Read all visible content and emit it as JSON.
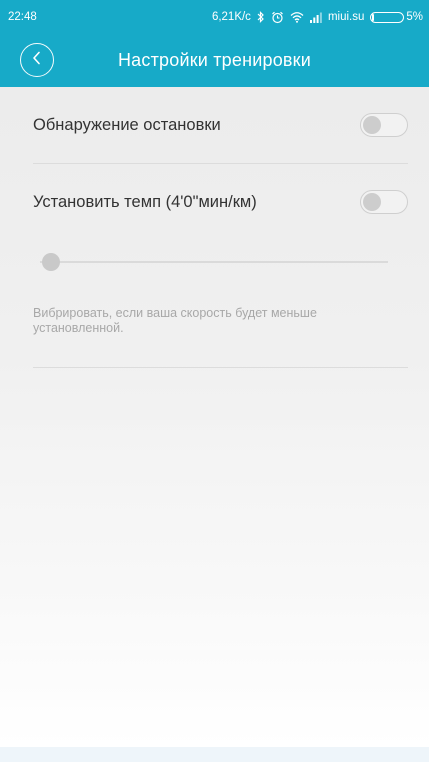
{
  "status_bar": {
    "time": "22:48",
    "net_speed": "6,21K/c",
    "carrier": "miui.su",
    "battery": "5%",
    "icons": [
      "bluetooth-icon",
      "alarm-icon",
      "wifi-icon",
      "signal-icon",
      "battery-icon"
    ]
  },
  "header": {
    "title": "Настройки тренировки",
    "back_icon": "back-icon"
  },
  "settings": {
    "stop_detection": {
      "label": "Обнаружение остановки",
      "enabled": false
    },
    "set_pace": {
      "label": "Установить темп (4'0\"мин/км)",
      "enabled": false
    },
    "pace_slider": {
      "value": 0
    },
    "hint": "Вибрировать, если ваша скорость будет меньше установленной."
  },
  "colors": {
    "accent": "#17aac8",
    "background": "#efefef"
  }
}
